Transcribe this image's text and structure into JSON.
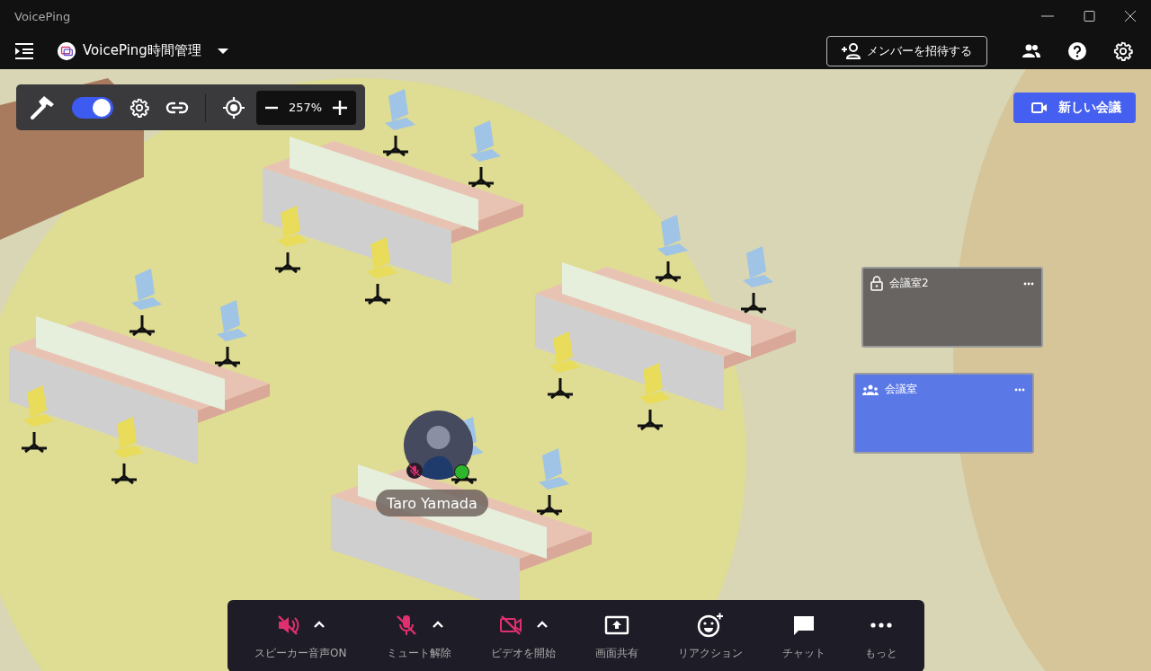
{
  "window": {
    "title": "VoicePing"
  },
  "header": {
    "workspace": "VoicePing時間管理",
    "invite_button": "メンバーを招待する"
  },
  "toolbar": {
    "mode_toggle": {
      "on": true
    },
    "zoom": "257%"
  },
  "new_meeting_button": "新しい会議",
  "rooms": [
    {
      "name": "会議室2",
      "kind": "locked",
      "color": "#686461"
    },
    {
      "name": "会議室",
      "kind": "group",
      "color": "#5a78e6"
    }
  ],
  "avatar": {
    "name": "Taro Yamada",
    "muted": true,
    "online": true
  },
  "controls": [
    {
      "label": "スピーカー音声ON",
      "kind": "speaker",
      "off": true,
      "has_menu": true
    },
    {
      "label": "ミュート解除",
      "kind": "mic",
      "off": true,
      "has_menu": true
    },
    {
      "label": "ビデオを開始",
      "kind": "video",
      "off": true,
      "has_menu": true
    },
    {
      "label": "画面共有",
      "kind": "share",
      "off": false,
      "has_menu": false
    },
    {
      "label": "リアクション",
      "kind": "reaction",
      "off": false,
      "has_menu": false
    },
    {
      "label": "チャット",
      "kind": "chat",
      "off": false,
      "has_menu": false
    },
    {
      "label": "もっと",
      "kind": "more",
      "off": false,
      "has_menu": false
    }
  ]
}
